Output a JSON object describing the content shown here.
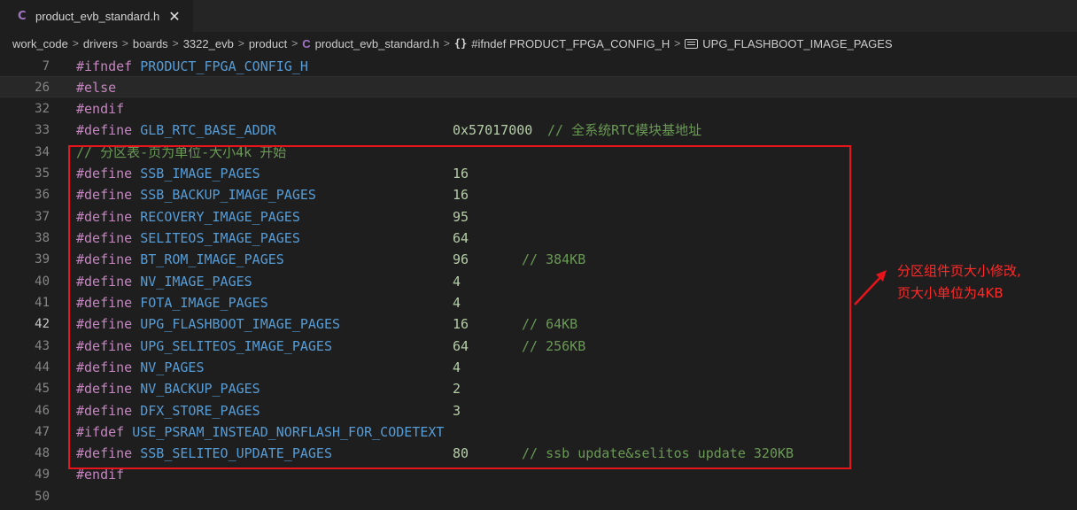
{
  "tab": {
    "icon_letter": "C",
    "title": "product_evb_standard.h",
    "close_glyph": "✕"
  },
  "breadcrumb": {
    "items": [
      "work_code",
      "drivers",
      "boards",
      "3322_evb",
      "product",
      "product_evb_standard.h",
      "#ifndef PRODUCT_FPGA_CONFIG_H",
      "UPG_FLASHBOOT_IMAGE_PAGES"
    ],
    "file_icon_letter": "C",
    "scope_icon": "{}"
  },
  "lines": [
    {
      "num": "7",
      "kw": "#ifndef",
      "name": "PRODUCT_FPGA_CONFIG_H",
      "value": "",
      "comment": ""
    },
    {
      "num": "26",
      "kw": "#else",
      "name": "",
      "value": "",
      "comment": ""
    },
    {
      "num": "32",
      "kw": "#endif",
      "name": "",
      "value": "",
      "comment": ""
    },
    {
      "num": "33",
      "kw": "#define",
      "name": "GLB_RTC_BASE_ADDR",
      "value": "0x57017000",
      "comment": "// 全系统RTC模块基地址"
    },
    {
      "num": "34",
      "kw": "",
      "name": "",
      "value": "",
      "comment": "// 分区表-页为单位-大小4k 开始"
    },
    {
      "num": "35",
      "kw": "#define",
      "name": "SSB_IMAGE_PAGES",
      "value": "16",
      "comment": ""
    },
    {
      "num": "36",
      "kw": "#define",
      "name": "SSB_BACKUP_IMAGE_PAGES",
      "value": "16",
      "comment": ""
    },
    {
      "num": "37",
      "kw": "#define",
      "name": "RECOVERY_IMAGE_PAGES",
      "value": "95",
      "comment": ""
    },
    {
      "num": "38",
      "kw": "#define",
      "name": "SELITEOS_IMAGE_PAGES",
      "value": "64",
      "comment": ""
    },
    {
      "num": "39",
      "kw": "#define",
      "name": "BT_ROM_IMAGE_PAGES",
      "value": "96",
      "comment": "// 384KB"
    },
    {
      "num": "40",
      "kw": "#define",
      "name": "NV_IMAGE_PAGES",
      "value": "4",
      "comment": ""
    },
    {
      "num": "41",
      "kw": "#define",
      "name": "FOTA_IMAGE_PAGES",
      "value": "4",
      "comment": ""
    },
    {
      "num": "42",
      "kw": "#define",
      "name": "UPG_FLASHBOOT_IMAGE_PAGES",
      "value": "16",
      "comment": "// 64KB"
    },
    {
      "num": "43",
      "kw": "#define",
      "name": "UPG_SELITEOS_IMAGE_PAGES",
      "value": "64",
      "comment": "// 256KB"
    },
    {
      "num": "44",
      "kw": "#define",
      "name": "NV_PAGES",
      "value": "4",
      "comment": ""
    },
    {
      "num": "45",
      "kw": "#define",
      "name": "NV_BACKUP_PAGES",
      "value": "2",
      "comment": ""
    },
    {
      "num": "46",
      "kw": "#define",
      "name": "DFX_STORE_PAGES",
      "value": "3",
      "comment": ""
    },
    {
      "num": "47",
      "kw": "#ifdef",
      "name": "USE_PSRAM_INSTEAD_NORFLASH_FOR_CODETEXT",
      "value": "",
      "comment": ""
    },
    {
      "num": "48",
      "kw": "#define",
      "name": "SSB_SELITEO_UPDATE_PAGES",
      "value": "80",
      "comment": "// ssb update&selitos update 320KB"
    },
    {
      "num": "49",
      "kw": "#endif",
      "name": "",
      "value": "",
      "comment": ""
    },
    {
      "num": "50",
      "kw": "",
      "name": "",
      "value": "",
      "comment": ""
    }
  ],
  "annotation": {
    "line1": "分区组件页大小修改,",
    "line2": "页大小单位为4KB",
    "color": "#ff2a2a"
  },
  "colors": {
    "keyword": "#c586c0",
    "identifier": "#569cd6",
    "number": "#b5cea8",
    "comment": "#6a9955",
    "highlight_box": "#e8141b"
  }
}
